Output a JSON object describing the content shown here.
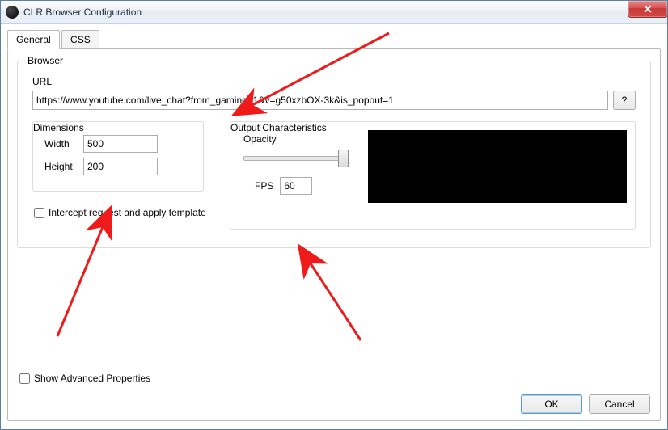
{
  "window": {
    "title": "CLR Browser Configuration"
  },
  "tabs": {
    "general": "General",
    "css": "CSS"
  },
  "browser": {
    "legend": "Browser",
    "url_label": "URL",
    "url_value": "https://www.youtube.com/live_chat?from_gaming=1&v=g50xzbOX-3k&is_popout=1",
    "help_label": "?",
    "intercept_label": "Intercept request and apply template",
    "intercept_checked": false
  },
  "dimensions": {
    "legend": "Dimensions",
    "width_label": "Width",
    "width_value": "500",
    "height_label": "Height",
    "height_value": "200"
  },
  "output": {
    "legend": "Output Characteristics",
    "opacity_label": "Opacity",
    "opacity_value": 1.0,
    "fps_label": "FPS",
    "fps_value": "60"
  },
  "advanced": {
    "label": "Show Advanced Properties",
    "checked": false
  },
  "buttons": {
    "ok": "OK",
    "cancel": "Cancel"
  }
}
